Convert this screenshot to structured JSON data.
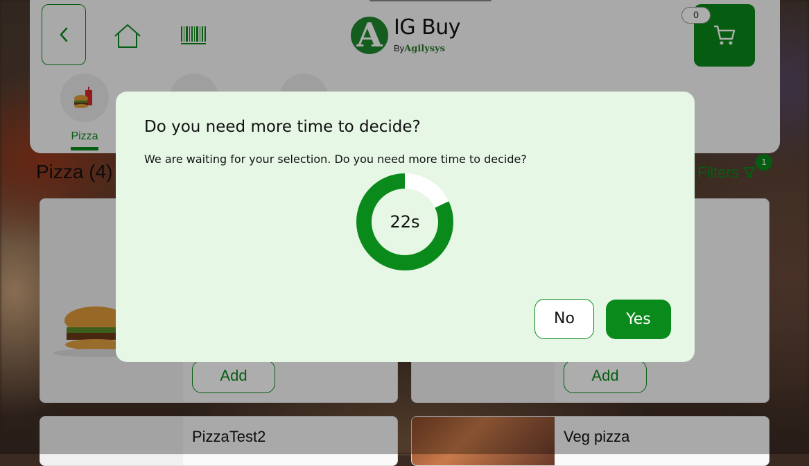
{
  "header": {
    "logo_letter": "A",
    "logo_title": "IG Buy",
    "logo_by": "By",
    "logo_brand": "Agilysys",
    "cart_count": "0",
    "categories": [
      {
        "label": "Pizza",
        "icon": "burger-drink-icon",
        "active": true
      },
      {
        "label": "",
        "icon": "add-icon",
        "active": false
      },
      {
        "label": "",
        "icon": "add-icon",
        "active": false
      }
    ]
  },
  "menu": {
    "section_title": "Pizza (4)",
    "filters_label": "Filters",
    "filters_count": "1",
    "items": [
      {
        "name": "",
        "add_label": "Add"
      },
      {
        "name": "",
        "add_label": "Add"
      },
      {
        "name": "PizzaTest2",
        "add_label": ""
      },
      {
        "name": "Veg pizza",
        "add_label": ""
      }
    ]
  },
  "dialog": {
    "title": "Do you need more time to decide?",
    "message": "We are waiting for your selection. Do you need more time to decide?",
    "timer_label": "22s",
    "timer_remaining_fraction": 0.82,
    "no_label": "No",
    "yes_label": "Yes"
  },
  "colors": {
    "accent": "#0a8a1a",
    "dialog_bg": "#e6f7e6"
  }
}
